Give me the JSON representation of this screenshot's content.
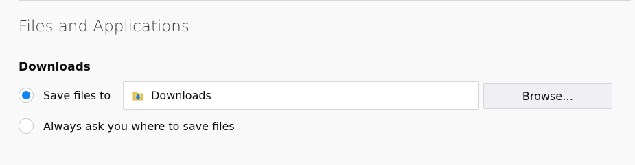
{
  "section": {
    "title": "Files and Applications"
  },
  "downloads": {
    "heading": "Downloads",
    "save_files_label": "Save files to",
    "save_files_selected": true,
    "save_path": "Downloads",
    "folder_icon": "downloads-folder-icon",
    "browse_label": "Browse…",
    "always_ask_label": "Always ask you where to save files",
    "always_ask_selected": false
  },
  "colors": {
    "accent": "#0a84ff",
    "background": "#f9f9fa",
    "border": "#d7d7db",
    "folder_yellow": "#f2c94c",
    "arrow_blue": "#0a84ff"
  }
}
